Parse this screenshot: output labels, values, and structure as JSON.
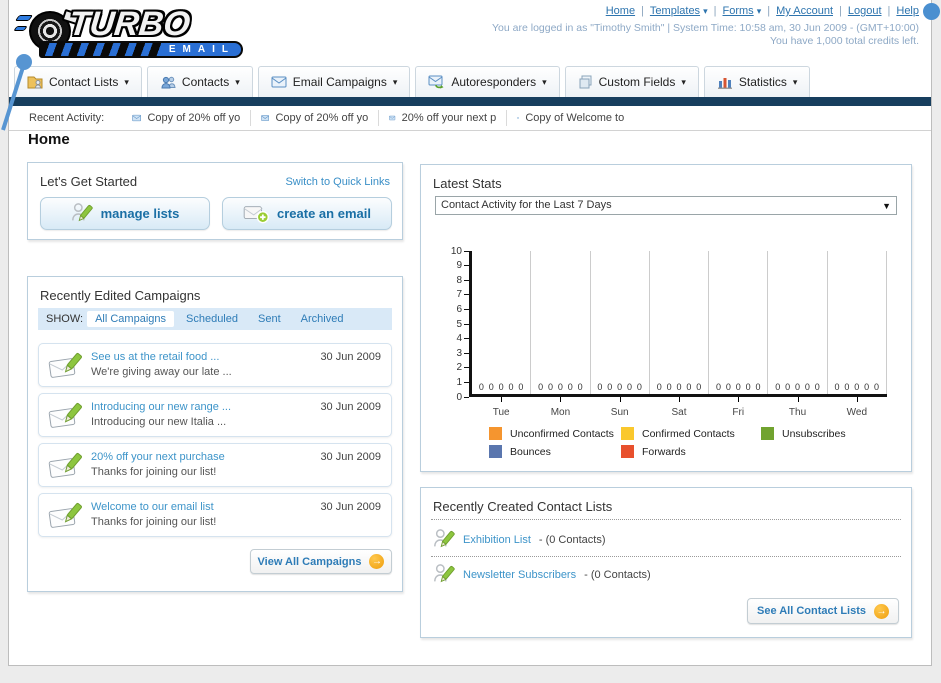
{
  "header": {
    "logo_line1": "TURBO",
    "logo_line2": "EMAIL",
    "nav": [
      "Home",
      "Templates",
      "Forms",
      "My Account",
      "Logout",
      "Help"
    ],
    "login_line": "You are logged in as \"Timothy Smith\" | System Time: 10:58 am, 30 Jun 2009 - (GMT+10:00)",
    "credits_line": "You have 1,000 total credits left."
  },
  "ui": {
    "sep": "|"
  },
  "tabs": [
    "Contact Lists",
    "Contacts",
    "Email Campaigns",
    "Autoresponders",
    "Custom Fields",
    "Statistics"
  ],
  "recent_activity": {
    "label": "Recent Activity:",
    "items": [
      "Copy of 20% off yo",
      "Copy of 20% off yo",
      "20% off your next p",
      "Copy of Welcome to"
    ]
  },
  "page_title": "Home",
  "get_started": {
    "title": "Let's Get Started",
    "switch_link": "Switch to Quick Links",
    "manage_lists_label": "manage lists",
    "create_email_label": "create an email"
  },
  "campaigns": {
    "title": "Recently Edited Campaigns",
    "show_label": "SHOW:",
    "filters": [
      "All Campaigns",
      "Scheduled",
      "Sent",
      "Archived"
    ],
    "active_filter": "All Campaigns",
    "items": [
      {
        "title": "See us at the retail food ...",
        "subtitle": "We're giving away our late ...",
        "date": "30 Jun 2009"
      },
      {
        "title": "Introducing our new range ...",
        "subtitle": "Introducing our new Italia ...",
        "date": "30 Jun 2009"
      },
      {
        "title": "20% off your next purchase",
        "subtitle": "Thanks for joining our list!",
        "date": "30 Jun 2009"
      },
      {
        "title": "Welcome to our email list",
        "subtitle": "Thanks for joining our list!",
        "date": "30 Jun 2009"
      }
    ],
    "view_all_label": "View All Campaigns"
  },
  "stats": {
    "title": "Latest Stats",
    "dropdown_value": "Contact Activity for the Last 7 Days",
    "chart_data": {
      "type": "bar",
      "title": "Contact Activity for the Last 7 Days",
      "categories": [
        "Tue",
        "Mon",
        "Sun",
        "Sat",
        "Fri",
        "Thu",
        "Wed"
      ],
      "series": [
        {
          "name": "Unconfirmed Contacts",
          "color": "#f5952f",
          "values": [
            0,
            0,
            0,
            0,
            0,
            0,
            0
          ]
        },
        {
          "name": "Confirmed Contacts",
          "color": "#fac82d",
          "values": [
            0,
            0,
            0,
            0,
            0,
            0,
            0
          ]
        },
        {
          "name": "Unsubscribes",
          "color": "#71a32f",
          "values": [
            0,
            0,
            0,
            0,
            0,
            0,
            0
          ]
        },
        {
          "name": "Bounces",
          "color": "#5a76ae",
          "values": [
            0,
            0,
            0,
            0,
            0,
            0,
            0
          ]
        },
        {
          "name": "Forwards",
          "color": "#e8502d",
          "values": [
            0,
            0,
            0,
            0,
            0,
            0,
            0
          ]
        }
      ],
      "ylim": [
        0,
        10
      ],
      "ytick_step": 1,
      "grid": "vertical",
      "legend_position": "bottom"
    }
  },
  "contact_lists": {
    "title": "Recently Created Contact Lists",
    "items": [
      {
        "name": "Exhibition List",
        "suffix": "- (0 Contacts)"
      },
      {
        "name": "Newsletter Subscribers",
        "suffix": "- (0 Contacts)"
      }
    ],
    "see_all_label": "See All Contact Lists"
  },
  "colors": {
    "navy_bar": "#173e5e",
    "link_blue": "#2e7cb7",
    "button_text_blue": "#1a6fa5",
    "arrow_orange": "#ee9d0c",
    "logo_blue": "#2a6fd4"
  }
}
